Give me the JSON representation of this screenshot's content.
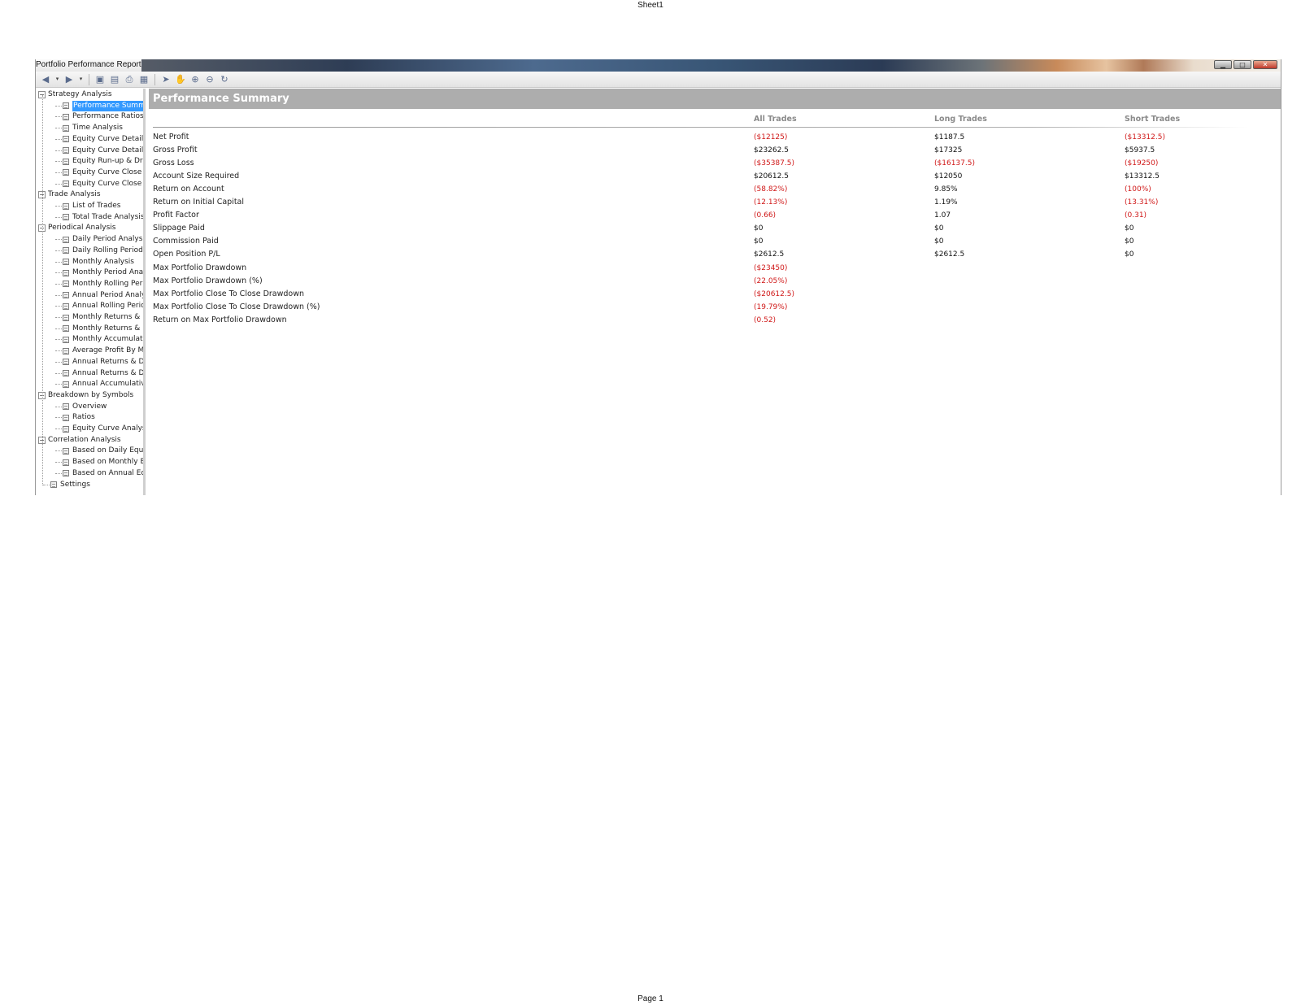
{
  "sheet": {
    "header": "Sheet1",
    "footer": "Page 1"
  },
  "window": {
    "title": "Portfolio Performance Report"
  },
  "toolbar": {
    "buttons": [
      "back-icon",
      "forward-icon",
      "save-icon",
      "export-icon",
      "print-icon",
      "page-setup-icon",
      "pointer-icon",
      "hand-icon",
      "zoom-in-icon",
      "zoom-out-icon",
      "zoom-reset-icon"
    ]
  },
  "tree": {
    "items": [
      {
        "label": "Strategy Analysis",
        "level": 0,
        "expander": "−"
      },
      {
        "label": "Performance Summary",
        "level": 1,
        "selected": true
      },
      {
        "label": "Performance Ratios",
        "level": 1
      },
      {
        "label": "Time Analysis",
        "level": 1
      },
      {
        "label": "Equity Curve Detailed",
        "level": 1
      },
      {
        "label": "Equity Curve Detailed",
        "level": 1
      },
      {
        "label": "Equity Run-up & Drawdown",
        "level": 1
      },
      {
        "label": "Equity Curve Close To Close",
        "level": 1
      },
      {
        "label": "Equity Curve Close To Close",
        "level": 1
      },
      {
        "label": "Trade Analysis",
        "level": 0,
        "expander": "−"
      },
      {
        "label": "List of Trades",
        "level": 1
      },
      {
        "label": "Total Trade Analysis",
        "level": 1
      },
      {
        "label": "Periodical Analysis",
        "level": 0,
        "expander": "−"
      },
      {
        "label": "Daily Period Analysis",
        "level": 1
      },
      {
        "label": "Daily Rolling Period Analysis",
        "level": 1
      },
      {
        "label": "Monthly Analysis",
        "level": 1
      },
      {
        "label": "Monthly Period Analysis",
        "level": 1
      },
      {
        "label": "Monthly Rolling Period",
        "level": 1
      },
      {
        "label": "Annual Period Analysis",
        "level": 1
      },
      {
        "label": "Annual Rolling Period",
        "level": 1
      },
      {
        "label": "Monthly Returns & Drawdown",
        "level": 1
      },
      {
        "label": "Monthly Returns & Drawdown",
        "level": 1
      },
      {
        "label": "Monthly Accumulative",
        "level": 1
      },
      {
        "label": "Average Profit By Month",
        "level": 1
      },
      {
        "label": "Annual Returns & Drawdown",
        "level": 1
      },
      {
        "label": "Annual Returns & Drawdown",
        "level": 1
      },
      {
        "label": "Annual Accumulative",
        "level": 1
      },
      {
        "label": "Breakdown by Symbols",
        "level": 0,
        "expander": "−"
      },
      {
        "label": "Overview",
        "level": 1
      },
      {
        "label": "Ratios",
        "level": 1
      },
      {
        "label": "Equity Curve Analysis",
        "level": 1
      },
      {
        "label": "Correlation Analysis",
        "level": 0,
        "expander": "−"
      },
      {
        "label": "Based on Daily Equity",
        "level": 1
      },
      {
        "label": "Based on Monthly Equity",
        "level": 1
      },
      {
        "label": "Based on Annual Equity",
        "level": 1
      },
      {
        "label": "Settings",
        "level": 0,
        "expander": ""
      }
    ]
  },
  "summary": {
    "title": "Performance Summary",
    "columns": [
      "All Trades",
      "Long Trades",
      "Short Trades"
    ],
    "rows": [
      {
        "label": "Net Profit",
        "all": "($12125)",
        "long": "$1187.5",
        "short": "($13312.5)"
      },
      {
        "label": "Gross Profit",
        "all": "$23262.5",
        "long": "$17325",
        "short": "$5937.5"
      },
      {
        "label": "Gross Loss",
        "all": "($35387.5)",
        "long": "($16137.5)",
        "short": "($19250)"
      },
      {
        "label": "Account Size Required",
        "all": "$20612.5",
        "long": "$12050",
        "short": "$13312.5"
      },
      {
        "label": "Return on Account",
        "all": "(58.82%)",
        "long": "9.85%",
        "short": "(100%)"
      },
      {
        "label": "Return on Initial Capital",
        "all": "(12.13%)",
        "long": "1.19%",
        "short": "(13.31%)"
      },
      {
        "label": "Profit Factor",
        "all": "(0.66)",
        "long": "1.07",
        "short": "(0.31)"
      },
      {
        "label": "Slippage Paid",
        "all": "$0",
        "long": "$0",
        "short": "$0"
      },
      {
        "label": "Commission Paid",
        "all": "$0",
        "long": "$0",
        "short": "$0"
      },
      {
        "label": "Open Position P/L",
        "all": "$2612.5",
        "long": "$2612.5",
        "short": "$0"
      },
      {
        "label": "Max Portfolio Drawdown",
        "all": "($23450)",
        "long": "",
        "short": ""
      },
      {
        "label": "Max Portfolio Drawdown (%)",
        "all": "(22.05%)",
        "long": "",
        "short": ""
      },
      {
        "label": "Max Portfolio Close To Close Drawdown",
        "all": "($20612.5)",
        "long": "",
        "short": ""
      },
      {
        "label": "Max Portfolio Close To Close Drawdown (%)",
        "all": "(19.79%)",
        "long": "",
        "short": ""
      },
      {
        "label": "Return on Max Portfolio Drawdown",
        "all": "(0.52)",
        "long": "",
        "short": ""
      }
    ]
  },
  "colors": {
    "negative": "#d01818",
    "selection": "#3399ff",
    "panel_header": "#adadad"
  }
}
